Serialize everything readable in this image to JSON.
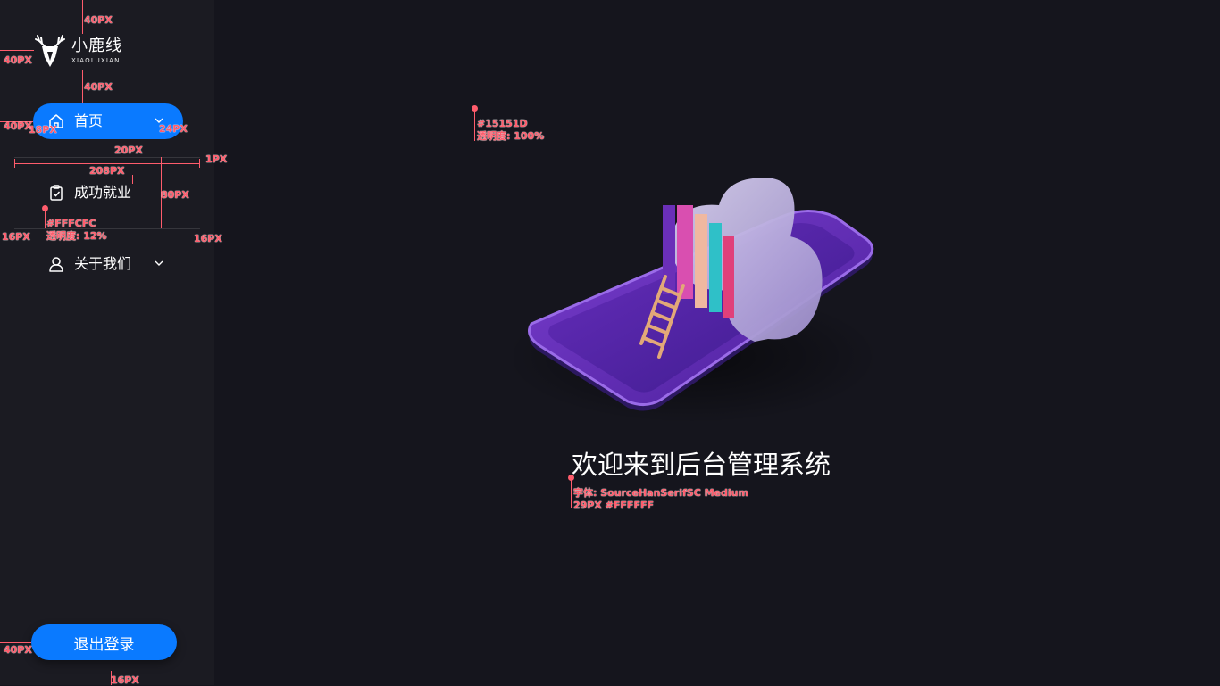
{
  "brand": {
    "name": "小鹿线",
    "sub": "XIAOLUXIAN"
  },
  "nav": [
    {
      "label": "首页",
      "icon": "home-icon",
      "active": true
    },
    {
      "label": "成功就业",
      "icon": "clipboard-check-icon",
      "active": false
    },
    {
      "label": "关于我们",
      "icon": "user-icon",
      "active": false
    }
  ],
  "logout_label": "退出登录",
  "welcome_text": "欢迎来到后台管理系统",
  "colors": {
    "background": "#15151D",
    "sidebar": "#1B1B22",
    "accent": "#0A7AFF",
    "divider": "#FCFCFC"
  },
  "annotations": {
    "top_40": "40PX",
    "logo_left_40": "40PX",
    "logo_gap_40": "40PX",
    "nav_left_40": "40PX",
    "icon_18": "18PX",
    "chev_24": "24PX",
    "gap_20": "20PX",
    "width_208": "208PX",
    "line_1": "1PX",
    "height_80": "80PX",
    "divider_color": "#FFFCFC",
    "divider_opacity": "透明度: 12%",
    "left_16": "16PX",
    "right_16": "16PX",
    "bg_color": "#15151D",
    "bg_opacity": "透明度: 100%",
    "font_note": "字体: SourceHanSerifSC Medium",
    "font_size_note": "29PX #FFFFFF",
    "logout_left_40": "40PX",
    "bottom_16": "16PX"
  }
}
